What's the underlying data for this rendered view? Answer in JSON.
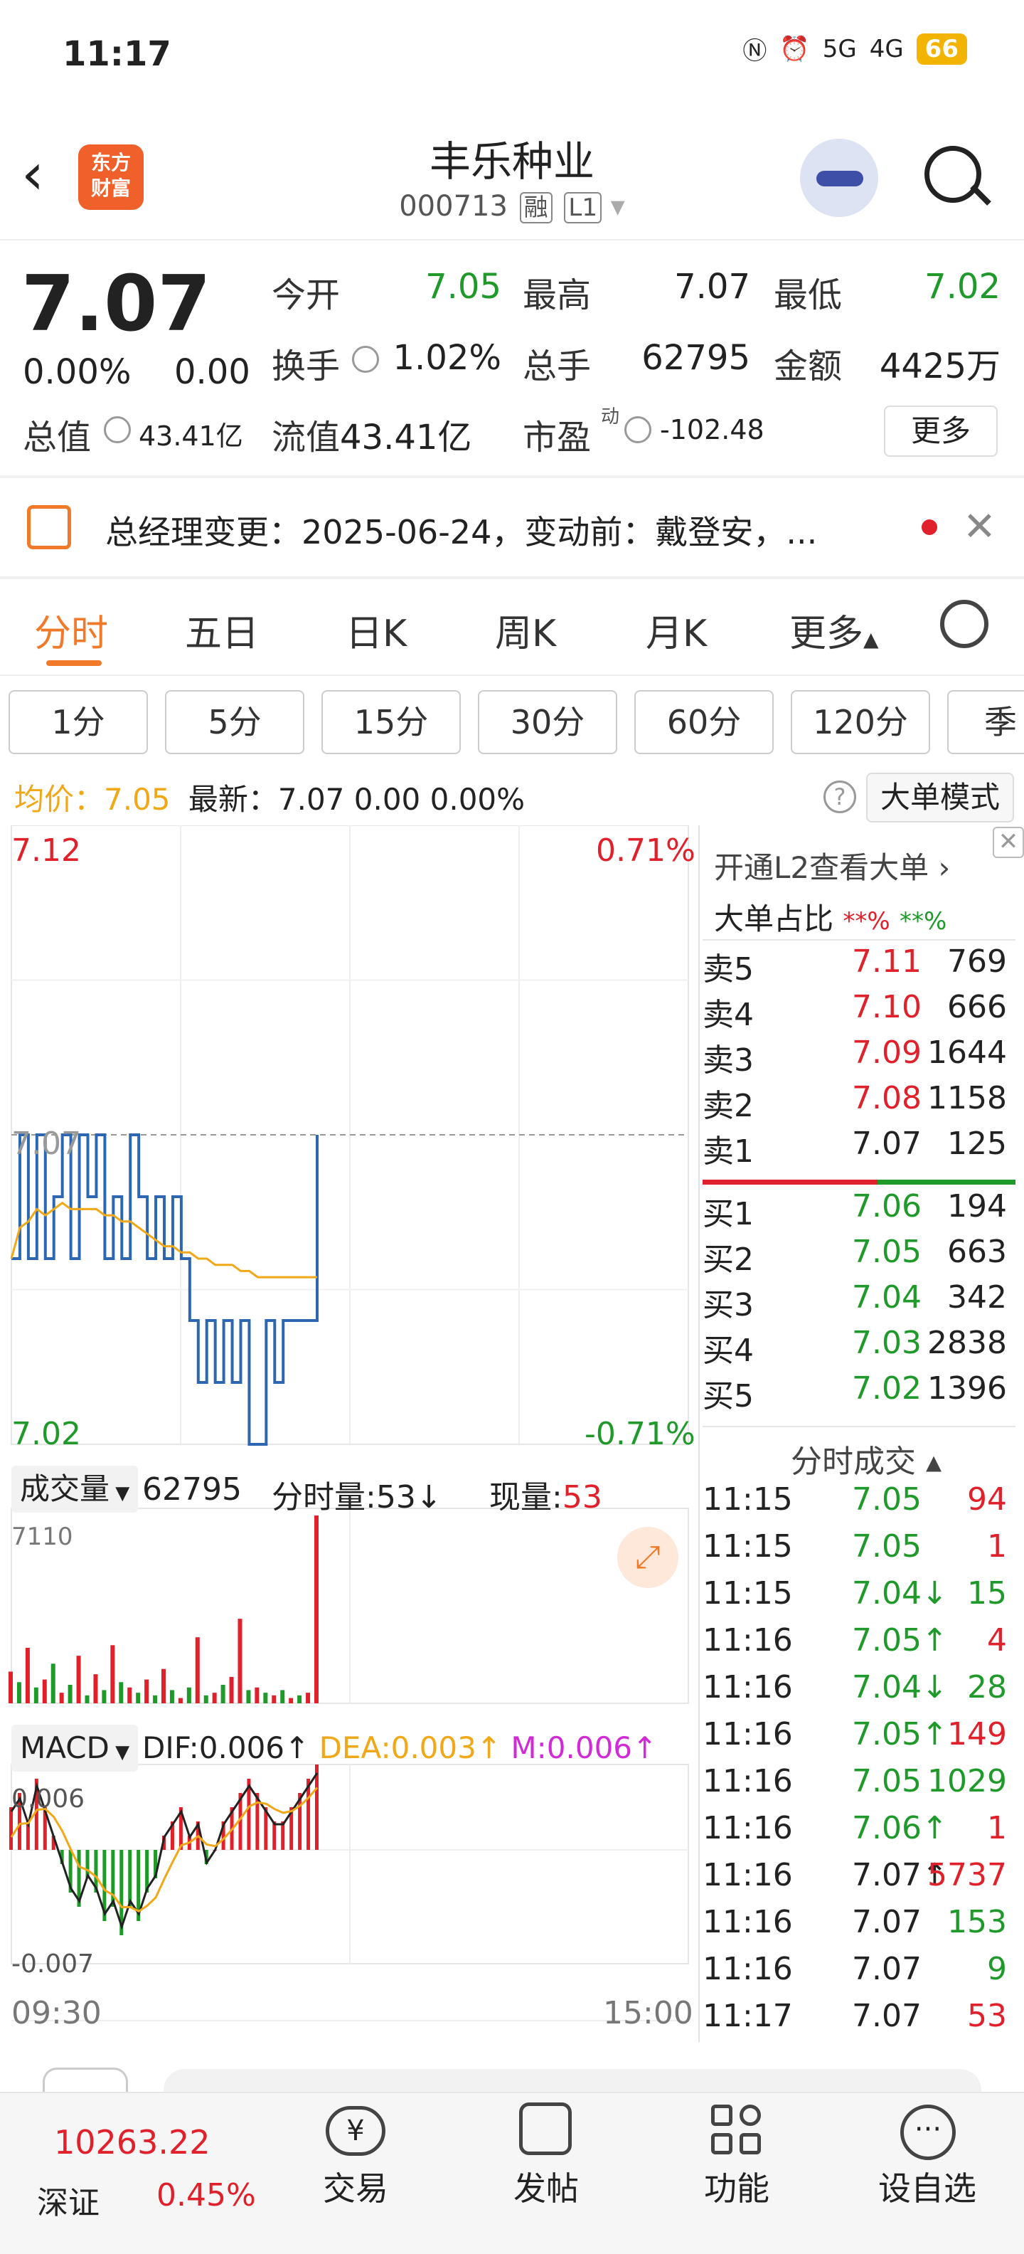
{
  "status_bar": {
    "time": "11:17",
    "signal_a": "5G",
    "signal_b": "4G",
    "battery": "66"
  },
  "header": {
    "stock_name": "丰乐种业",
    "stock_code": "000713",
    "tag_margin": "融",
    "tag_level": "L1",
    "logo_text_top": "东方",
    "logo_text_bottom": "财富"
  },
  "quote": {
    "price": "7.07",
    "change_pct": "0.00%",
    "change": "0.00",
    "open_label": "今开",
    "open": "7.05",
    "high_label": "最高",
    "high": "7.07",
    "low_label": "最低",
    "low": "7.02",
    "turnover_label": "换手",
    "turnover": "1.02%",
    "volume_label": "总手",
    "volume": "62795",
    "amount_label": "金额",
    "amount": "4425万",
    "mcap_label": "总值",
    "mcap": "43.41亿",
    "float_label": "流值",
    "float": "43.41亿",
    "pe_label": "市盈",
    "pe_sup": "动",
    "pe": "-102.48",
    "more_button": "更多"
  },
  "notice": {
    "text": "总经理变更：2025-06-24，变动前：戴登安，..."
  },
  "tabs": [
    "分时",
    "五日",
    "日K",
    "周K",
    "月K",
    "更多"
  ],
  "periods": [
    "1分",
    "5分",
    "15分",
    "30分",
    "60分",
    "120分",
    "季"
  ],
  "avg_info": {
    "avg_label": "均价：",
    "avg_value": "7.05",
    "latest": "最新：7.07  0.00  0.00%",
    "help": "?",
    "big_mode": "大单模式"
  },
  "chart_data": {
    "type": "line",
    "title": "",
    "price_axis": {
      "top": "7.12",
      "bottom": "7.02",
      "ref": "7.07",
      "top_pct": "0.71%",
      "bottom_pct": "-0.71%"
    },
    "ylim": [
      7.02,
      7.12
    ],
    "price_series": [
      7.05,
      7.07,
      7.05,
      7.07,
      7.05,
      7.06,
      7.07,
      7.05,
      7.07,
      7.06,
      7.07,
      7.05,
      7.06,
      7.05,
      7.07,
      7.06,
      7.05,
      7.06,
      7.05,
      7.06,
      7.05,
      7.04,
      7.03,
      7.04,
      7.03,
      7.04,
      7.03,
      7.04,
      7.02,
      7.02,
      7.04,
      7.03,
      7.04,
      7.04,
      7.04,
      7.04,
      7.07
    ],
    "avg_series": [
      7.05,
      7.055,
      7.056,
      7.058,
      7.057,
      7.058,
      7.059,
      7.058,
      7.058,
      7.058,
      7.058,
      7.057,
      7.057,
      7.056,
      7.056,
      7.055,
      7.054,
      7.053,
      7.052,
      7.052,
      7.051,
      7.051,
      7.05,
      7.05,
      7.049,
      7.049,
      7.049,
      7.048,
      7.048,
      7.047,
      7.047,
      7.047,
      7.047,
      7.047,
      7.047,
      7.047,
      7.047
    ],
    "volume_label": "成交量",
    "volume_total": "62795",
    "volume_per": "分时量:53↓",
    "volume_now_label": "现量:",
    "volume_now": "53",
    "volume_max": "7110",
    "volume_bars": [
      1200,
      800,
      2100,
      600,
      900,
      1500,
      400,
      700,
      1800,
      300,
      1100,
      500,
      2200,
      800,
      600,
      400,
      900,
      300,
      1300,
      500,
      200,
      600,
      2500,
      300,
      400,
      700,
      1000,
      3200,
      500,
      600,
      400,
      300,
      500,
      200,
      300,
      400,
      7110
    ],
    "volume_colors": [
      "r",
      "g",
      "r",
      "g",
      "r",
      "g",
      "r",
      "g",
      "r",
      "g",
      "r",
      "g",
      "r",
      "g",
      "r",
      "g",
      "r",
      "g",
      "r",
      "g",
      "r",
      "g",
      "r",
      "g",
      "r",
      "g",
      "r",
      "r",
      "g",
      "r",
      "g",
      "r",
      "g",
      "r",
      "g",
      "r",
      "r"
    ],
    "macd_label": "MACD",
    "dif": "DIF:0.006↑",
    "dea": "DEA:0.003↑",
    "m": "M:0.006↑",
    "macd_top": "0.006",
    "macd_bottom": "-0.007",
    "macd_bars": [
      0.003,
      0.004,
      0.002,
      0.005,
      0.003,
      0.001,
      -0.001,
      -0.003,
      -0.004,
      -0.002,
      -0.003,
      -0.005,
      -0.004,
      -0.006,
      -0.004,
      -0.005,
      -0.003,
      -0.002,
      0.001,
      0.002,
      0.003,
      0.001,
      0.002,
      -0.001,
      0.0,
      0.002,
      0.003,
      0.004,
      0.005,
      0.004,
      0.003,
      0.002,
      0.002,
      0.003,
      0.004,
      0.005,
      0.006
    ],
    "time_start": "09:30",
    "time_end": "15:00"
  },
  "panel": {
    "l2_link": "开通L2查看大单 ›",
    "big_ratio_label": "大单占比",
    "big_ratio_buy": "**%",
    "big_ratio_sell": "**%",
    "sells": [
      {
        "label": "卖5",
        "price": "7.11",
        "vol": "769"
      },
      {
        "label": "卖4",
        "price": "7.10",
        "vol": "666"
      },
      {
        "label": "卖3",
        "price": "7.09",
        "vol": "1644"
      },
      {
        "label": "卖2",
        "price": "7.08",
        "vol": "1158"
      },
      {
        "label": "卖1",
        "price": "7.07",
        "vol": "125"
      }
    ],
    "buys": [
      {
        "label": "买1",
        "price": "7.06",
        "vol": "194"
      },
      {
        "label": "买2",
        "price": "7.05",
        "vol": "663"
      },
      {
        "label": "买3",
        "price": "7.04",
        "vol": "342"
      },
      {
        "label": "买4",
        "price": "7.03",
        "vol": "2838"
      },
      {
        "label": "买5",
        "price": "7.02",
        "vol": "1396"
      }
    ],
    "trades_title": "分时成交 ▴",
    "trades": [
      {
        "time": "11:15",
        "price": "7.05",
        "vol": "94"
      },
      {
        "time": "11:15",
        "price": "7.05",
        "vol": "1"
      },
      {
        "time": "11:15",
        "price": "7.04↓",
        "vol": "15"
      },
      {
        "time": "11:16",
        "price": "7.05↑",
        "vol": "4"
      },
      {
        "time": "11:16",
        "price": "7.04↓",
        "vol": "28"
      },
      {
        "time": "11:16",
        "price": "7.05↑",
        "vol": "149"
      },
      {
        "time": "11:16",
        "price": "7.05",
        "vol": "1029"
      },
      {
        "time": "11:16",
        "price": "7.06↑",
        "vol": "1"
      },
      {
        "time": "11:16",
        "price": "7.07↑",
        "vol": "5737"
      },
      {
        "time": "11:16",
        "price": "7.07",
        "vol": "153"
      },
      {
        "time": "11:16",
        "price": "7.07",
        "vol": "9"
      },
      {
        "time": "11:17",
        "price": "7.07",
        "vol": "53"
      }
    ]
  },
  "bottom_bar": {
    "index_value": "10263.22",
    "index_name": "深证",
    "index_change": "0.45%",
    "items": [
      "交易",
      "发帖",
      "功能",
      "设自选"
    ]
  },
  "colors": {
    "up": "#e0202a",
    "down": "#1f9a2a",
    "accent": "#f07a2a",
    "avg_line": "#f0a818",
    "price_line": "#2e67b1"
  }
}
